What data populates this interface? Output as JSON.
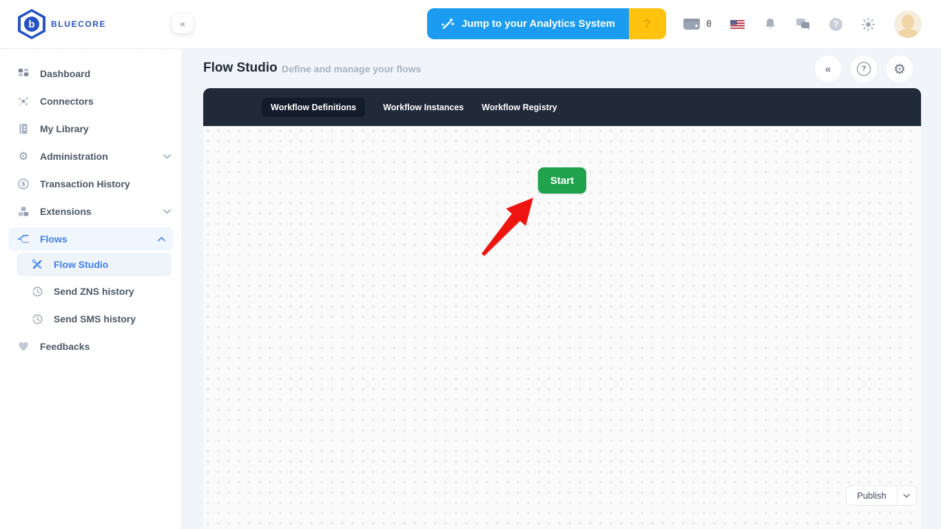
{
  "glyphs": {
    "collapse": "«",
    "question": "?",
    "gear": "⚙"
  },
  "header": {
    "brand": "BLUECORE",
    "jump_button_label": "Jump to your Analytics System",
    "jump_help_badge": "?",
    "wallet_count": "0"
  },
  "sidebar": {
    "items": [
      {
        "label": "Dashboard"
      },
      {
        "label": "Connectors"
      },
      {
        "label": "My Library"
      },
      {
        "label": "Administration",
        "expandable": true
      },
      {
        "label": "Transaction History"
      },
      {
        "label": "Extensions",
        "expandable": true
      },
      {
        "label": "Flows",
        "expandable": true,
        "expanded": true,
        "active": true
      },
      {
        "label": "Flow Studio",
        "sub": true,
        "active": true
      },
      {
        "label": "Send ZNS history",
        "sub": true
      },
      {
        "label": "Send SMS history",
        "sub": true
      },
      {
        "label": "Feedbacks"
      }
    ]
  },
  "main": {
    "title": "Flow Studio",
    "subtitle": "Define and manage your flows",
    "tabs": [
      {
        "label": "Workflow Definitions",
        "active": true
      },
      {
        "label": "Workflow Instances",
        "active": false
      },
      {
        "label": "Workflow Registry",
        "active": false
      }
    ],
    "canvas": {
      "start_label": "Start",
      "publish_label": "Publish"
    }
  },
  "colors": {
    "brand_blue": "#2553C4",
    "accent_blue": "#1B9CF1",
    "badge_yellow": "#FFC20D",
    "link_blue": "#3D7EF0",
    "tabbar_dark": "#212A38",
    "start_green": "#21A24D",
    "arrow_red": "#EE1511",
    "canvas_bg": "#FAFAFA"
  }
}
